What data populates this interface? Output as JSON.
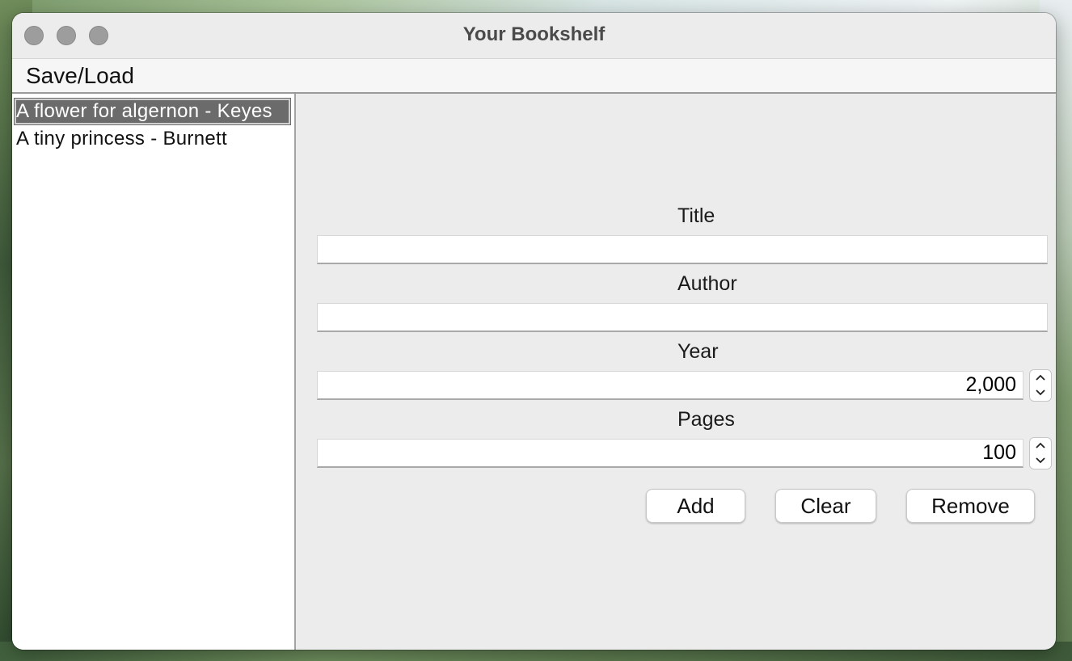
{
  "window": {
    "title": "Your Bookshelf"
  },
  "menu": {
    "items": [
      "Save/Load"
    ]
  },
  "books": [
    {
      "label": "A flower for algernon - Keyes",
      "selected": true
    },
    {
      "label": "A tiny princess - Burnett",
      "selected": false
    }
  ],
  "form": {
    "title_label": "Title",
    "title_value": "",
    "author_label": "Author",
    "author_value": "",
    "year_label": "Year",
    "year_value": "2,000",
    "pages_label": "Pages",
    "pages_value": "100"
  },
  "buttons": {
    "add": "Add",
    "clear": "Clear",
    "remove": "Remove"
  },
  "icons": {
    "spin_up": "chevron-up-icon",
    "spin_down": "chevron-down-icon"
  },
  "colors": {
    "selection": "#6b6b6b",
    "traffic_light_inactive": "#9d9d9d"
  }
}
